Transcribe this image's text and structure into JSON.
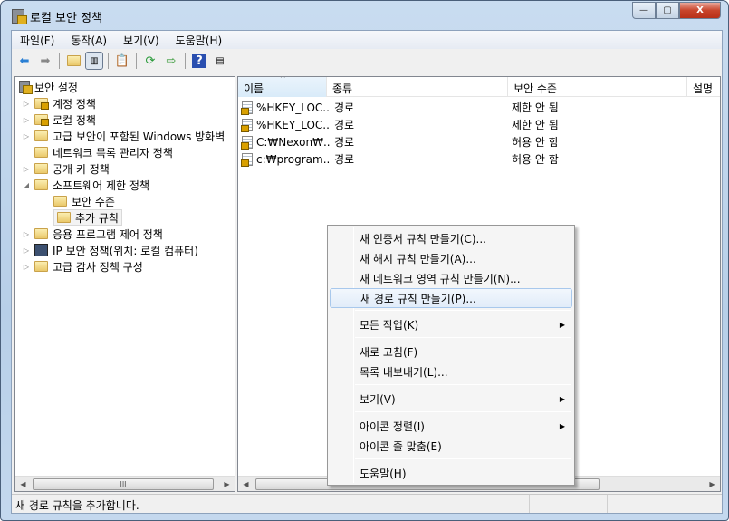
{
  "window": {
    "title": "로컬 보안 정책",
    "minimize": "—",
    "maximize": "▢",
    "close": "X"
  },
  "menu": [
    "파일(F)",
    "동작(A)",
    "보기(V)",
    "도움말(H)"
  ],
  "toolbar_icons": [
    "back-arrow-icon",
    "forward-arrow-icon",
    "up-folder-icon",
    "show-hide-tree-icon",
    "clipboard-icon",
    "refresh-icon",
    "export-list-icon",
    "help-icon",
    "action-pane-icon"
  ],
  "tree": {
    "root": "보안 설정",
    "items": [
      {
        "label": "계정 정책",
        "expander": "▷",
        "icon": "locked-folder"
      },
      {
        "label": "로컬 정책",
        "expander": "▷",
        "icon": "locked-folder"
      },
      {
        "label": "고급 보안이 포함된 Windows 방화벽",
        "expander": "▷",
        "icon": "folder"
      },
      {
        "label": "네트워크 목록 관리자 정책",
        "expander": "",
        "icon": "folder"
      },
      {
        "label": "공개 키 정책",
        "expander": "▷",
        "icon": "folder"
      },
      {
        "label": "소프트웨어 제한 정책",
        "expander": "◢",
        "icon": "folder"
      },
      {
        "label": "보안 수준",
        "expander": "",
        "icon": "folder",
        "child": true
      },
      {
        "label": "추가 규칙",
        "expander": "",
        "icon": "folder",
        "child": true,
        "selected": true
      },
      {
        "label": "응용 프로그램 제어 정책",
        "expander": "▷",
        "icon": "folder"
      },
      {
        "label": "IP 보안 정책(위치: 로컬 컴퓨터)",
        "expander": "▷",
        "icon": "computer"
      },
      {
        "label": "고급 감사 정책 구성",
        "expander": "▷",
        "icon": "folder"
      }
    ]
  },
  "list": {
    "columns": [
      "이름",
      "종류",
      "보안 수준",
      "설명"
    ],
    "sort_indicator": "^",
    "rows": [
      {
        "name": "%HKEY_LOC...",
        "type": "경로",
        "level": "제한 안 됨"
      },
      {
        "name": "%HKEY_LOC...",
        "type": "경로",
        "level": "제한 안 됨"
      },
      {
        "name": "C:₩Nexon₩...",
        "type": "경로",
        "level": "허용 안 함"
      },
      {
        "name": "c:₩program...",
        "type": "경로",
        "level": "허용 안 함"
      }
    ]
  },
  "scroll": {
    "left_arrow": "◀",
    "right_arrow": "▶",
    "grip": "III"
  },
  "context_menu": {
    "items": [
      {
        "label": "새 인증서 규칙 만들기(C)..."
      },
      {
        "label": "새 해시 규칙 만들기(A)..."
      },
      {
        "label": "새 네트워크 영역 규칙 만들기(N)..."
      },
      {
        "label": "새 경로 규칙 만들기(P)...",
        "highlighted": true
      },
      {
        "label": "모든 작업(K)",
        "submenu": "▶"
      },
      {
        "label": "새로 고침(F)"
      },
      {
        "label": "목록 내보내기(L)..."
      },
      {
        "label": "보기(V)",
        "submenu": "▶"
      },
      {
        "label": "아이콘 정렬(I)",
        "submenu": "▶"
      },
      {
        "label": "아이콘 줄 맞춤(E)"
      },
      {
        "label": "도움말(H)"
      }
    ]
  },
  "status": {
    "text": "새 경로 규칙을 추가합니다."
  }
}
